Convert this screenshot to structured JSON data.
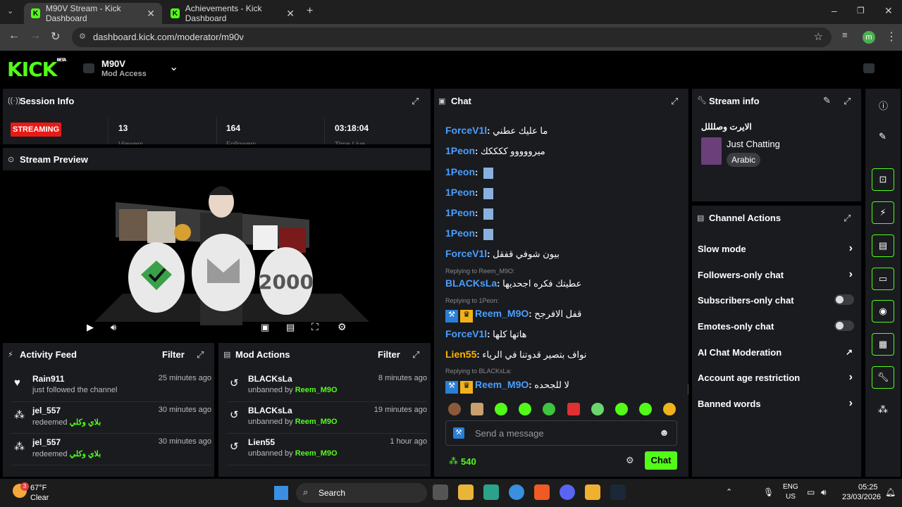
{
  "browser": {
    "tabs": [
      {
        "title": "M90V Stream - Kick Dashboard",
        "active": true
      },
      {
        "title": "Achievements - Kick Dashboard",
        "active": false
      }
    ],
    "url": "dashboard.kick.com/moderator/m90v",
    "profile_initial": "m"
  },
  "header": {
    "logo": "KICK",
    "logo_badge": "BETA",
    "channel_name": "M90V",
    "access": "Mod Access"
  },
  "session": {
    "title": "Session Info",
    "status": "STREAMING",
    "viewers": "13",
    "viewers_label": "Viewers",
    "followers": "164",
    "followers_label": "Followers",
    "time_live": "03:18:04",
    "time_label": "Time Live"
  },
  "preview": {
    "title": "Stream Preview",
    "overlay_number": "2000"
  },
  "activity": {
    "title": "Activity Feed",
    "filter": "Filter",
    "items": [
      {
        "name": "Rain911",
        "sub": "just followed the channel",
        "time": "25 minutes ago",
        "reward": ""
      },
      {
        "name": "jel_557",
        "sub": "redeemed",
        "time": "30 minutes ago",
        "reward": "بلاي وكلي"
      },
      {
        "name": "jel_557",
        "sub": "redeemed",
        "time": "30 minutes ago",
        "reward": "بلاي وكلي"
      }
    ]
  },
  "mod_actions": {
    "title": "Mod Actions",
    "filter": "Filter",
    "items": [
      {
        "name": "BLACKsLa",
        "sub": "unbanned by",
        "by": "Reem_M9O",
        "time": "8 minutes ago"
      },
      {
        "name": "BLACKsLa",
        "sub": "unbanned by",
        "by": "Reem_M9O",
        "time": "19 minutes ago"
      },
      {
        "name": "Lien55",
        "sub": "unbanned by",
        "by": "Reem_M9O",
        "time": "1 hour ago"
      }
    ]
  },
  "chat": {
    "title": "Chat",
    "messages": [
      {
        "user": "ForceV1l",
        "text": "ما عليك عطني",
        "color": "#4a9eff",
        "reply": ""
      },
      {
        "user": "1Peon",
        "text": "ميرووووو ككككك",
        "color": "#4a9eff",
        "reply": ""
      },
      {
        "user": "1Peon",
        "text": "",
        "color": "#4a9eff",
        "reply": ""
      },
      {
        "user": "1Peon",
        "text": "",
        "color": "#4a9eff",
        "reply": ""
      },
      {
        "user": "1Peon",
        "text": "",
        "color": "#4a9eff",
        "reply": ""
      },
      {
        "user": "1Peon",
        "text": "",
        "color": "#4a9eff",
        "reply": ""
      },
      {
        "user": "ForceV1l",
        "text": "بيون شوفي قفقل",
        "color": "#4a9eff",
        "reply": ""
      },
      {
        "user": "BLACKsLa",
        "text": "عطيتك فكره اجحديها",
        "color": "#4a9eff",
        "reply": "Replying to Reem_M9O:"
      },
      {
        "user": "Reem_M9O",
        "text": "قفل الافرجح",
        "color": "#4a9eff",
        "reply": "Replying to 1Peon:"
      },
      {
        "user": "ForceV1l",
        "text": "هاتها كلها",
        "color": "#4a9eff",
        "reply": ""
      },
      {
        "user": "Lien55",
        "text": "نواف بتصير قدوتنا في الرياء",
        "color": "#ffb300",
        "reply": ""
      },
      {
        "user": "Reem_M9O",
        "text": "لا للجحده",
        "color": "#4a9eff",
        "reply": "Replying to BLACKsLa:"
      }
    ],
    "input_placeholder": "Send a message",
    "points": "540",
    "send_label": "Chat"
  },
  "stream_info": {
    "title": "Stream info",
    "stream_title": "الايرت وصلللل",
    "category": "Just Chatting",
    "tag": "Arabic"
  },
  "channel_actions": {
    "title": "Channel Actions",
    "items": [
      {
        "label": "Slow mode",
        "control": "chevron"
      },
      {
        "label": "Followers-only chat",
        "control": "chevron"
      },
      {
        "label": "Subscribers-only chat",
        "control": "toggle"
      },
      {
        "label": "Emotes-only chat",
        "control": "toggle"
      },
      {
        "label": "AI Chat Moderation",
        "control": "external"
      },
      {
        "label": "Account age restriction",
        "control": "chevron"
      },
      {
        "label": "Banned words",
        "control": "chevron"
      }
    ]
  },
  "taskbar": {
    "temp": "67°F",
    "weather": "Clear",
    "search": "Search",
    "lang": "ENG",
    "region": "US",
    "time": "05:25",
    "date": "23/03/2026",
    "notif_count": "3"
  },
  "colors": {
    "kick_green": "#53fc18",
    "panel": "#191b1f",
    "live_red": "#e91916"
  }
}
